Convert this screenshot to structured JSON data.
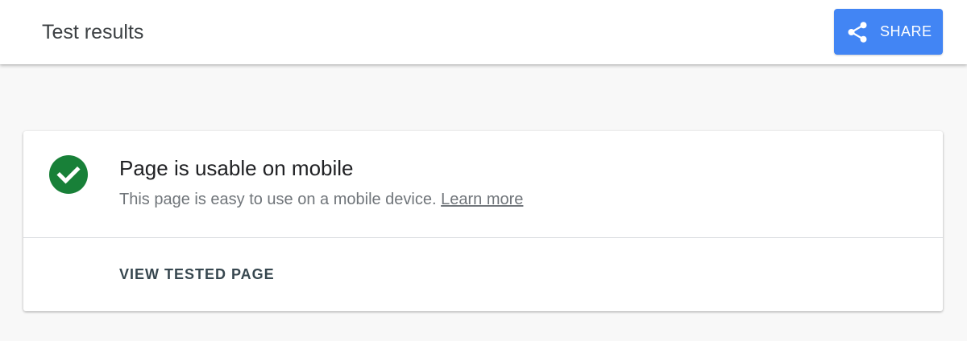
{
  "header": {
    "title": "Test results",
    "share_label": "SHARE",
    "share_icon": "share-icon",
    "share_color": "#4285f4"
  },
  "result": {
    "status_icon": "check-circle-icon",
    "status_color": "#188038",
    "heading": "Page is usable on mobile",
    "description": "This page is easy to use on a mobile device.",
    "learn_more_label": "Learn more",
    "view_button_label": "VIEW TESTED PAGE"
  }
}
